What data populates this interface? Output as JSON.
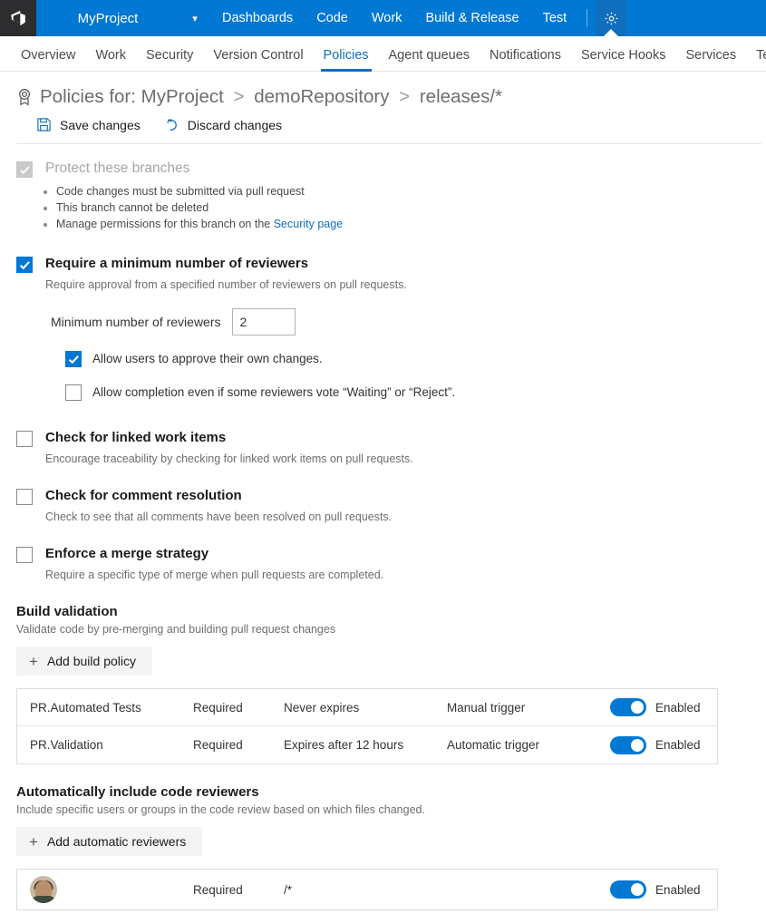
{
  "topbar": {
    "logo_icon": "azure-devops-logo-icon",
    "project_name": "MyProject",
    "project_chevron_icon": "chevron-down-icon",
    "nav": [
      {
        "label": "Dashboards"
      },
      {
        "label": "Code"
      },
      {
        "label": "Work"
      },
      {
        "label": "Build & Release"
      },
      {
        "label": "Test"
      }
    ],
    "settings_icon": "gear-icon",
    "accent_color": "#0078d4",
    "logo_bg_color": "#2d2d30"
  },
  "subnav": {
    "items": [
      {
        "label": "Overview",
        "active": false
      },
      {
        "label": "Work",
        "active": false
      },
      {
        "label": "Security",
        "active": false
      },
      {
        "label": "Version Control",
        "active": false
      },
      {
        "label": "Policies",
        "active": true
      },
      {
        "label": "Agent queues",
        "active": false
      },
      {
        "label": "Notifications",
        "active": false
      },
      {
        "label": "Service Hooks",
        "active": false
      },
      {
        "label": "Services",
        "active": false
      },
      {
        "label": "Test",
        "active": false
      }
    ],
    "active_color": "#106ebe"
  },
  "heading": {
    "icon": "policy-ribbon-icon",
    "prefix": "Policies for:",
    "crumb1": "MyProject",
    "sep": ">",
    "crumb2": "demoRepository",
    "crumb3": "releases/*"
  },
  "commandbar": {
    "save": {
      "label": "Save changes",
      "icon": "save-disk-icon"
    },
    "discard": {
      "label": "Discard changes",
      "icon": "undo-arrow-icon"
    }
  },
  "policies": {
    "protect": {
      "title": "Protect these branches",
      "checked": true,
      "disabled": true,
      "bullets": [
        "Code changes must be submitted via pull request",
        "This branch cannot be deleted",
        "Manage permissions for this branch on the "
      ],
      "security_link": "Security page"
    },
    "min_reviewers": {
      "title": "Require a minimum number of reviewers",
      "checked": true,
      "desc": "Require approval from a specified number of reviewers on pull requests.",
      "field_label": "Minimum number of reviewers",
      "field_value": "2",
      "field_placeholder": "",
      "options": [
        {
          "label": "Allow users to approve their own changes.",
          "checked": true
        },
        {
          "label": "Allow completion even if some reviewers vote “Waiting” or “Reject”.",
          "checked": false
        }
      ]
    },
    "linked_work_items": {
      "title": "Check for linked work items",
      "checked": false,
      "desc": "Encourage traceability by checking for linked work items on pull requests."
    },
    "comment_resolution": {
      "title": "Check for comment resolution",
      "checked": false,
      "desc": "Check to see that all comments have been resolved on pull requests."
    },
    "merge_strategy": {
      "title": "Enforce a merge strategy",
      "checked": false,
      "desc": "Require a specific type of merge when pull requests are completed."
    }
  },
  "build_validation": {
    "title": "Build validation",
    "desc": "Validate code by pre-merging and building pull request changes",
    "add_button": "Add build policy",
    "add_icon": "plus-icon",
    "rows": [
      {
        "name": "PR.Automated Tests",
        "required": "Required",
        "expiry": "Never expires",
        "trigger": "Manual trigger",
        "toggle_on": true,
        "toggle_label": "Enabled"
      },
      {
        "name": "PR.Validation",
        "required": "Required",
        "expiry": "Expires after 12 hours",
        "trigger": "Automatic trigger",
        "toggle_on": true,
        "toggle_label": "Enabled"
      }
    ]
  },
  "auto_reviewers": {
    "title": "Automatically include code reviewers",
    "desc": "Include specific users or groups in the code review based on which files changed.",
    "add_button": "Add automatic reviewers",
    "add_icon": "plus-icon",
    "rows": [
      {
        "avatar": "user-avatar",
        "required": "Required",
        "path": "/*",
        "trigger": "",
        "toggle_on": true,
        "toggle_label": "Enabled"
      }
    ]
  }
}
